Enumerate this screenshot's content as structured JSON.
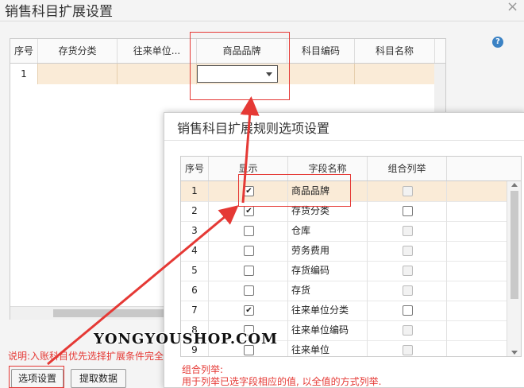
{
  "window": {
    "title": "销售科目扩展设置",
    "close": "×",
    "help": "?"
  },
  "main_grid": {
    "columns": [
      "序号",
      "存货分类",
      "往来单位...",
      "商品品牌",
      "科目编码",
      "科目名称"
    ],
    "rows": [
      {
        "index": "1"
      }
    ]
  },
  "footer": {
    "note": "说明:入账科目优先选择扩展条件完全",
    "options_button": "选项设置",
    "extract_button": "提取数据"
  },
  "dialog": {
    "title": "销售科目扩展规则选项设置",
    "columns": [
      "序号",
      "显示",
      "字段名称",
      "组合列举"
    ],
    "rows": [
      {
        "index": "1",
        "show": true,
        "field": "商品品牌",
        "combo_enabled": false,
        "combo": false
      },
      {
        "index": "2",
        "show": true,
        "field": "存货分类",
        "combo_enabled": true,
        "combo": false
      },
      {
        "index": "3",
        "show": false,
        "field": "仓库",
        "combo_enabled": false,
        "combo": false
      },
      {
        "index": "4",
        "show": false,
        "field": "劳务费用",
        "combo_enabled": false,
        "combo": false
      },
      {
        "index": "5",
        "show": false,
        "field": "存货编码",
        "combo_enabled": false,
        "combo": false
      },
      {
        "index": "6",
        "show": false,
        "field": "存货",
        "combo_enabled": false,
        "combo": false
      },
      {
        "index": "7",
        "show": true,
        "field": "往来单位分类",
        "combo_enabled": true,
        "combo": false
      },
      {
        "index": "8",
        "show": false,
        "field": "往来单位编码",
        "combo_enabled": false,
        "combo": false
      },
      {
        "index": "9",
        "show": false,
        "field": "往来单位",
        "combo_enabled": false,
        "combo": false
      }
    ],
    "note_line1": "组合列举:",
    "note_line2": "用于列举已选字段相应的值, 以全值的方式列举."
  },
  "watermark": "YONGYOUSHOP.COM",
  "colors": {
    "highlight": "#e53935",
    "selected_row": "#faebd7",
    "help": "#3b82c4"
  }
}
